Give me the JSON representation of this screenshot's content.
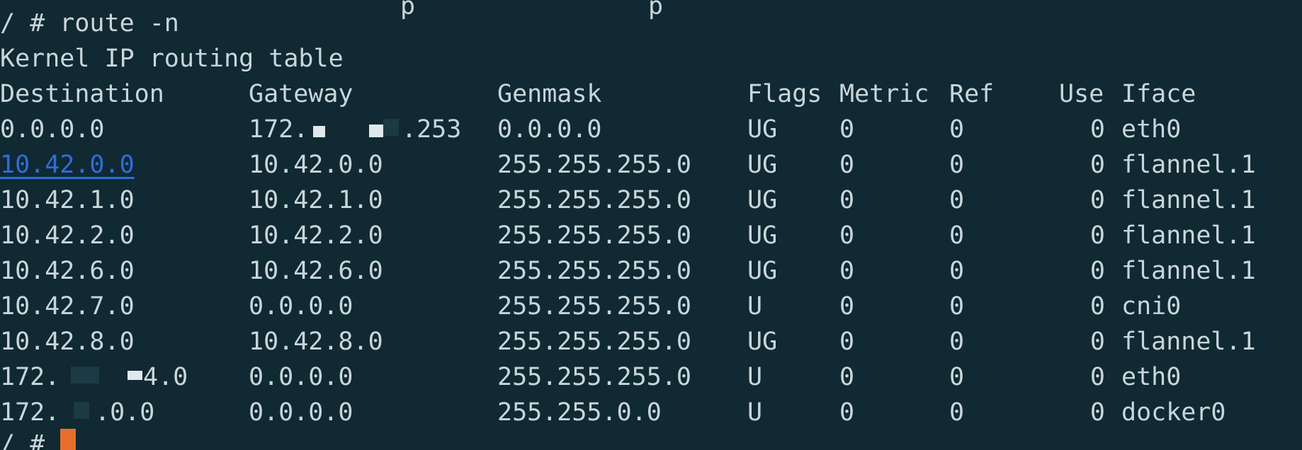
{
  "terminal": {
    "top_fragment": "p",
    "command": "/ # route -n",
    "table_title": "Kernel IP routing table",
    "columns": {
      "destination": "Destination",
      "gateway": "Gateway",
      "genmask": "Genmask",
      "flags": "Flags",
      "metric": "Metric",
      "ref": "Ref",
      "use": "Use",
      "iface": "Iface"
    },
    "rows": [
      {
        "destination": "0.0.0.0",
        "gateway": "172.",
        "gateway_suffix": ".253",
        "genmask": "0.0.0.0",
        "flags": "UG",
        "metric": "0",
        "ref": "0",
        "use": "0",
        "iface": "eth0"
      },
      {
        "destination": "10.42.0.0",
        "gateway": "10.42.0.0",
        "genmask": "255.255.255.0",
        "flags": "UG",
        "metric": "0",
        "ref": "0",
        "use": "0",
        "iface": "flannel.1"
      },
      {
        "destination": "10.42.1.0",
        "gateway": "10.42.1.0",
        "genmask": "255.255.255.0",
        "flags": "UG",
        "metric": "0",
        "ref": "0",
        "use": "0",
        "iface": "flannel.1"
      },
      {
        "destination": "10.42.2.0",
        "gateway": "10.42.2.0",
        "genmask": "255.255.255.0",
        "flags": "UG",
        "metric": "0",
        "ref": "0",
        "use": "0",
        "iface": "flannel.1"
      },
      {
        "destination": "10.42.6.0",
        "gateway": "10.42.6.0",
        "genmask": "255.255.255.0",
        "flags": "UG",
        "metric": "0",
        "ref": "0",
        "use": "0",
        "iface": "flannel.1"
      },
      {
        "destination": "10.42.7.0",
        "gateway": "0.0.0.0",
        "genmask": "255.255.255.0",
        "flags": "U",
        "metric": "0",
        "ref": "0",
        "use": "0",
        "iface": "cni0"
      },
      {
        "destination": "10.42.8.0",
        "gateway": "10.42.8.0",
        "genmask": "255.255.255.0",
        "flags": "UG",
        "metric": "0",
        "ref": "0",
        "use": "0",
        "iface": "flannel.1"
      },
      {
        "destination": "172.",
        "destination_suffix": "4.0",
        "gateway": "0.0.0.0",
        "genmask": "255.255.255.0",
        "flags": "U",
        "metric": "0",
        "ref": "0",
        "use": "0",
        "iface": "eth0"
      },
      {
        "destination": "172.",
        "destination_suffix": ".0.0",
        "gateway": "0.0.0.0",
        "genmask": "255.255.0.0",
        "flags": "U",
        "metric": "0",
        "ref": "0",
        "use": "0",
        "iface": "docker0"
      }
    ],
    "prompt": "/ #",
    "colors": {
      "background": "#102933",
      "text": "#c9d6d9",
      "link": "#2e6ed6",
      "cursor": "#e56f2b"
    }
  }
}
